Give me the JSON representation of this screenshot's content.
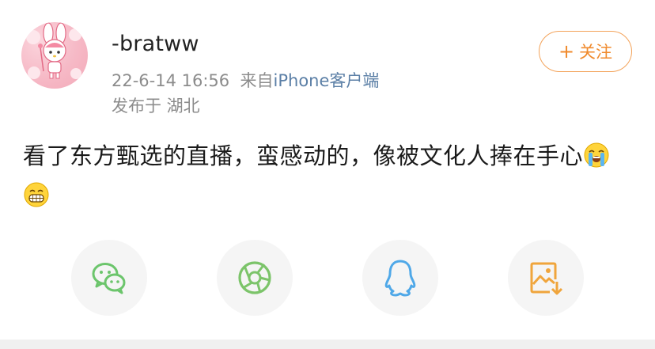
{
  "post": {
    "username": "-bratww",
    "timestamp": "22-6-14 16:56",
    "source_prefix": "来自",
    "source": "iPhone客户端",
    "location": "发布于 湖北",
    "follow_label": "关注",
    "text": "看了东方甄选的直播，蛮感动的，像被文化人捧在手心",
    "emojis": [
      "crying-face-emoji",
      "grinning-face-emoji"
    ]
  },
  "share": {
    "buttons": [
      {
        "icon": "wechat-icon",
        "color": "#6cc56c"
      },
      {
        "icon": "moments-icon",
        "color": "#7cc46a"
      },
      {
        "icon": "qq-icon",
        "color": "#4fa8e8"
      },
      {
        "icon": "save-image-icon",
        "color": "#f0a53c"
      }
    ]
  }
}
